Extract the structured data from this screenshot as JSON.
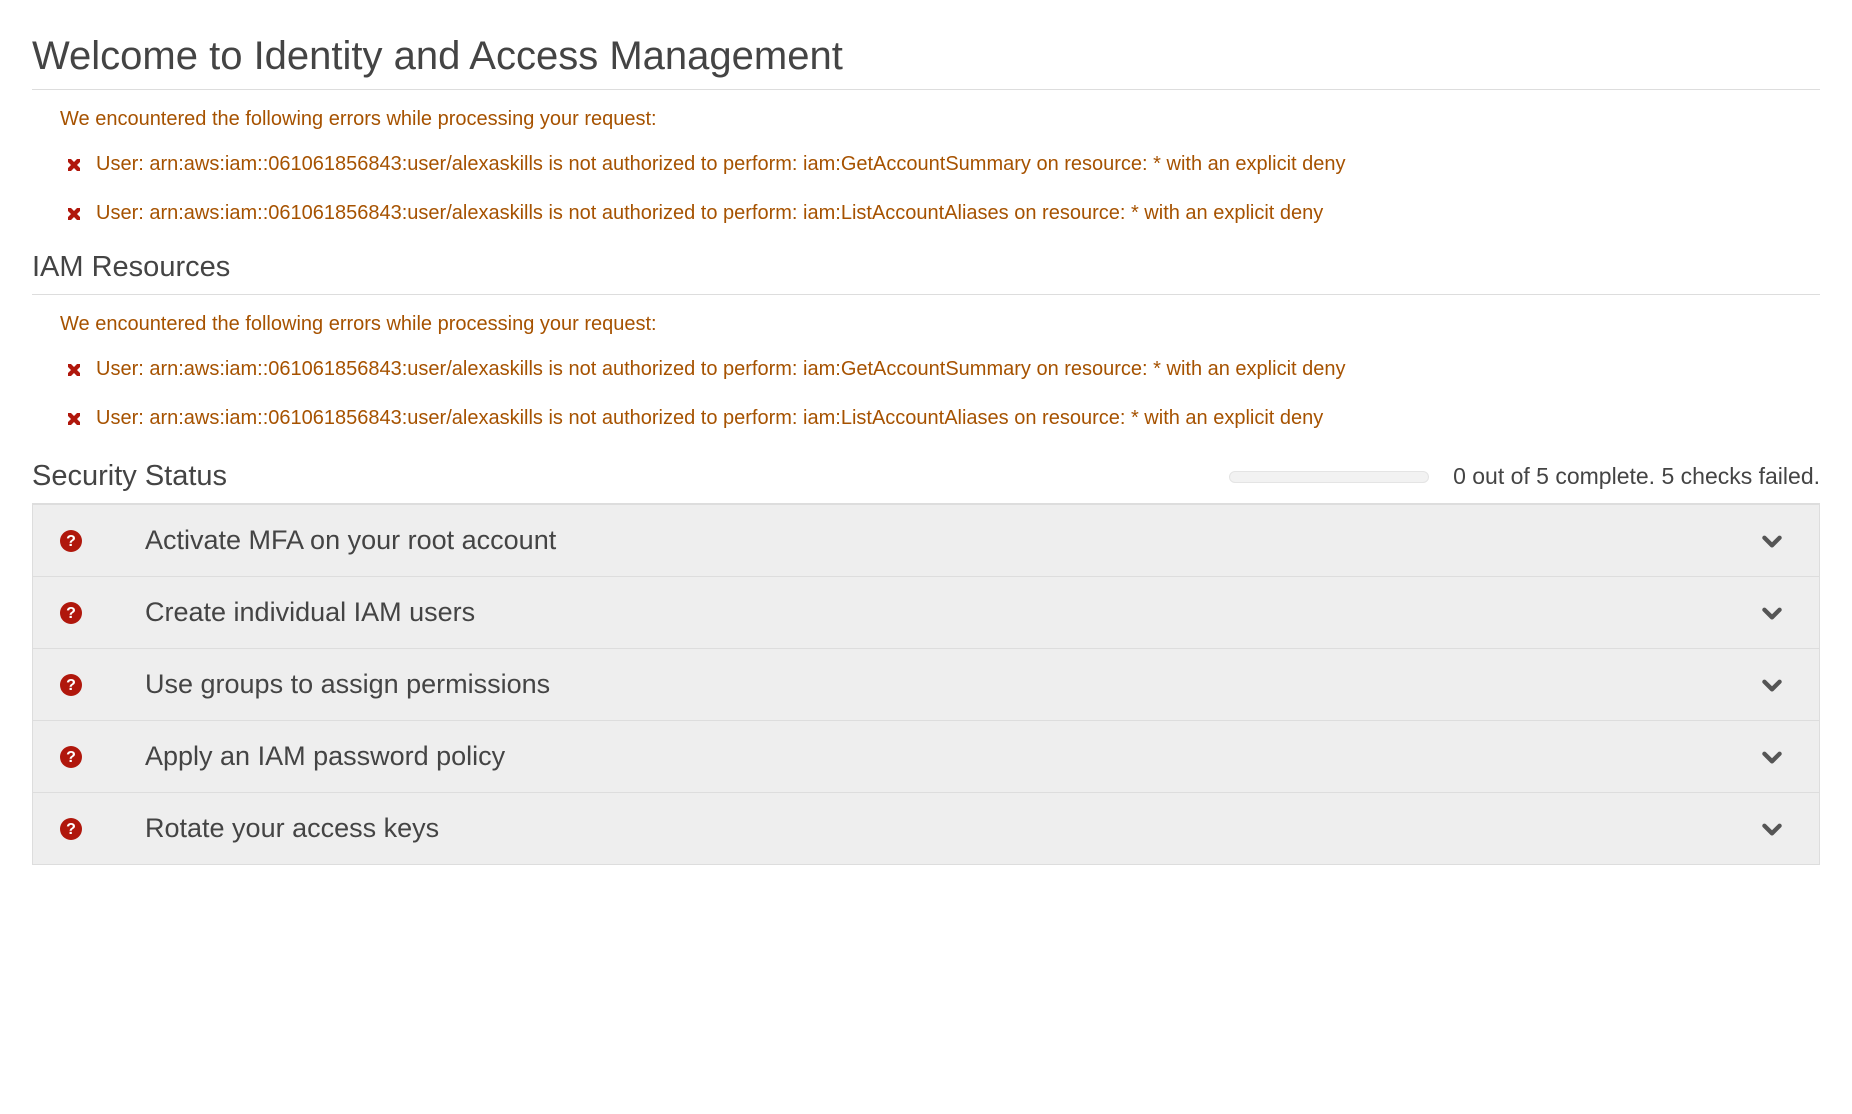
{
  "page_title": "Welcome to Identity and Access Management",
  "errors_top": {
    "intro": "We encountered the following errors while processing your request:",
    "items": [
      "User: arn:aws:iam::061061856843:user/alexaskills is not authorized to perform: iam:GetAccountSummary on resource: * with an explicit deny",
      "User: arn:aws:iam::061061856843:user/alexaskills is not authorized to perform: iam:ListAccountAliases on resource: * with an explicit deny"
    ]
  },
  "iam_resources_title": "IAM Resources",
  "errors_iam": {
    "intro": "We encountered the following errors while processing your request:",
    "items": [
      "User: arn:aws:iam::061061856843:user/alexaskills is not authorized to perform: iam:GetAccountSummary on resource: * with an explicit deny",
      "User: arn:aws:iam::061061856843:user/alexaskills is not authorized to perform: iam:ListAccountAliases on resource: * with an explicit deny"
    ]
  },
  "security_status_title": "Security Status",
  "security_status_summary": "0 out of 5 complete. 5 checks failed.",
  "security_checks": [
    {
      "label": "Activate MFA on your root account"
    },
    {
      "label": "Create individual IAM users"
    },
    {
      "label": "Use groups to assign permissions"
    },
    {
      "label": "Apply an IAM password policy"
    },
    {
      "label": "Rotate your access keys"
    }
  ],
  "colors": {
    "error_text": "#a65200",
    "error_icon": "#b0170c",
    "info_icon": "#b0170c",
    "row_bg": "#eeeeee"
  }
}
